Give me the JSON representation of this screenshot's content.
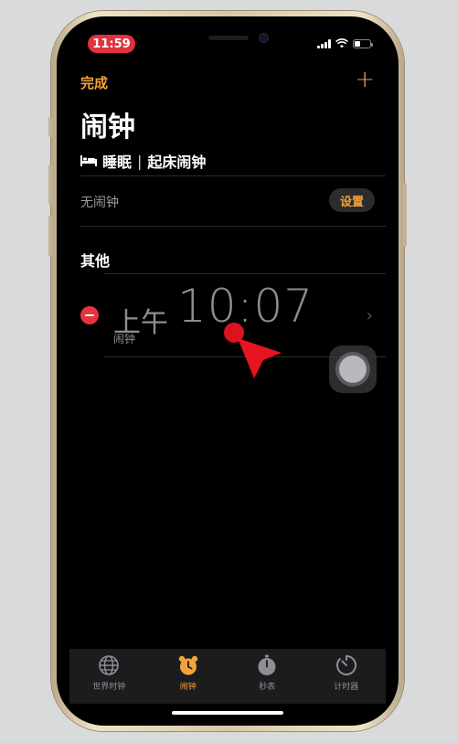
{
  "status_bar": {
    "time": "11:59"
  },
  "nav": {
    "done_label": "完成",
    "add_label": "+"
  },
  "page": {
    "title": "闹钟"
  },
  "sleep": {
    "label": "睡眠",
    "separator": "|",
    "wake_label": "起床闹钟",
    "no_alarm": "无闹钟",
    "setup_label": "设置"
  },
  "others": {
    "heading": "其他",
    "alarms": [
      {
        "ampm": "上午",
        "time": "10:07",
        "label": "闹钟"
      }
    ]
  },
  "tabs": [
    {
      "label": "世界时钟",
      "icon": "globe-icon",
      "active": false
    },
    {
      "label": "闹钟",
      "icon": "alarm-clock-icon",
      "active": true
    },
    {
      "label": "秒表",
      "icon": "stopwatch-icon",
      "active": false
    },
    {
      "label": "计时器",
      "icon": "timer-icon",
      "active": false
    }
  ],
  "colors": {
    "accent": "#f2a33a",
    "delete": "#e5333f",
    "background": "#000000",
    "time_pill": "#e0333d"
  }
}
